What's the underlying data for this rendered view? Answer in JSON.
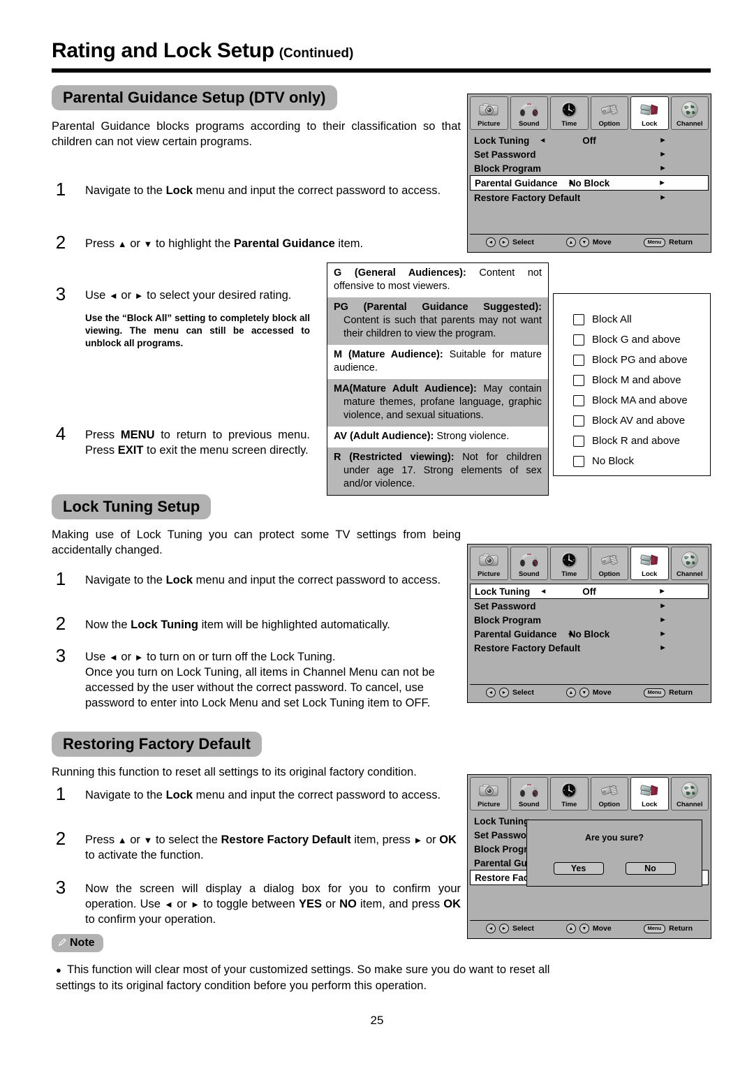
{
  "header": {
    "title_main": "Rating and Lock Setup",
    "title_suffix": "(Continued)"
  },
  "sections": {
    "parental": {
      "chip": "Parental Guidance Setup (DTV only)",
      "intro": "Parental Guidance blocks programs according to their classification so that children can not view certain programs."
    },
    "lock_tuning": {
      "chip": "Lock Tuning Setup",
      "intro": "Making use of Lock Tuning you can protect some TV settings from being accidentally changed."
    },
    "restoring": {
      "chip": "Restoring Factory Default",
      "intro": "Running this function to reset all settings to its original factory condition."
    },
    "note": {
      "chip": "Note",
      "bullet": "●",
      "text": "This function will clear most of your customized settings.  So make sure you do want to reset all settings to its original factory condition before you perform this operation."
    }
  },
  "steps_parental": [
    {
      "num": "1",
      "text_html": "Navigate to the <b>Lock</b> menu and input the correct password to access."
    },
    {
      "num": "2",
      "text_html": "Press <span class=\"arr\">▲</span> or <span class=\"arr\">▼</span> to highlight the <b>Parental Guidance</b> item."
    },
    {
      "num": "3",
      "text_html": "Use <span class=\"arr\">◄</span> or <span class=\"arr\">►</span> to select your desired rating.",
      "sub_bold": "Use the “Block All” setting to completely block all viewing. The menu can still be accessed to unblock all programs."
    },
    {
      "num": "4",
      "text_html": "Press <b>MENU</b> to return to previous menu. Press <b>EXIT</b> to exit the menu screen directly."
    }
  ],
  "steps_lock": [
    {
      "num": "1",
      "text_html": "Navigate to the <b>Lock</b> menu and input the correct password to access."
    },
    {
      "num": "2",
      "text_html": "Now the <b>Lock Tuning</b> item will be highlighted automatically."
    },
    {
      "num": "3",
      "text_html": "Use <span class=\"arr\">◄</span> or <span class=\"arr\">►</span> to turn on or turn off the Lock Tuning.<br>Once you turn on Lock Tuning, all items in Channel Menu can not be accessed by the user without the correct password. To cancel, use password to enter into Lock Menu and set Lock Tuning item to OFF."
    }
  ],
  "steps_restore": [
    {
      "num": "1",
      "text_html": "Navigate to the <b>Lock</b> menu and input the correct password to access."
    },
    {
      "num": "2",
      "text_html": "Press <span class=\"arr\">▲</span> or <span class=\"arr\">▼</span> to select the <b>Restore Factory Default</b> item, press <span class=\"arr\">►</span> or <b>OK</b> to activate the function."
    },
    {
      "num": "3",
      "text_html": "Now the screen will display a dialog box for you to confirm your operation. Use <span class=\"arr\">◄</span> or <span class=\"arr\">►</span> to toggle between <b>YES</b> or <b>NO</b> item, and press <b>OK</b> to confirm your operation."
    }
  ],
  "ratings": [
    {
      "code": "G (General Audiences):",
      "desc": " Content not offensive to most viewers.",
      "shaded": false,
      "indent": false
    },
    {
      "code": "PG (Parental Guidance Suggested):",
      "desc": " Content is such that parents may not want their children to view the program.",
      "shaded": true,
      "indent": true
    },
    {
      "code": "M (Mature Audience):",
      "desc": " Suitable for mature audience.",
      "shaded": false,
      "indent": false
    },
    {
      "code": "MA(Mature Adult Audience):",
      "desc": " May contain mature themes, profane language, graphic violence, and sexual situations.",
      "shaded": true,
      "indent": true
    },
    {
      "code": "AV (Adult Audience):",
      "desc": " Strong violence.",
      "shaded": false,
      "indent": false
    },
    {
      "code": "R (Restricted viewing):",
      "desc": " Not for children under age 17. Strong elements of sex and/or violence.",
      "shaded": true,
      "indent": true
    }
  ],
  "block_options": [
    {
      "label": "Block All",
      "checked": false
    },
    {
      "label": "Block G and above",
      "checked": false
    },
    {
      "label": "Block PG and above",
      "checked": false
    },
    {
      "label": "Block M and above",
      "checked": false
    },
    {
      "label": "Block MA and above",
      "checked": false
    },
    {
      "label": "Block AV and above",
      "checked": false
    },
    {
      "label": "Block R and above",
      "checked": false
    },
    {
      "label": "No Block",
      "checked": false
    }
  ],
  "osd": {
    "tabs": [
      {
        "label": "Picture",
        "icon": "camera-icon",
        "active": false
      },
      {
        "label": "Sound",
        "icon": "headphones-icon",
        "active": false
      },
      {
        "label": "Time",
        "icon": "clock-icon",
        "active": false
      },
      {
        "label": "Option",
        "icon": "connector-icon",
        "active": false
      },
      {
        "label": "Lock",
        "icon": "padlock-icon",
        "active": true
      },
      {
        "label": "Channel",
        "icon": "globe-icon",
        "active": false
      }
    ],
    "footer": {
      "select_keys": "◄►",
      "select_label": "Select",
      "move_keys": "▲▼",
      "move_label": "Move",
      "menu_key": "Menu",
      "menu_label": "Return"
    },
    "menu1": {
      "rows": [
        {
          "label": "Lock Tuning",
          "value": "Off",
          "left_arrow": true,
          "right_arrow": true,
          "selected": false
        },
        {
          "label": "Set Password",
          "value": "",
          "left_arrow": false,
          "right_arrow": true,
          "selected": false
        },
        {
          "label": "Block Program",
          "value": "",
          "left_arrow": false,
          "right_arrow": true,
          "selected": false
        },
        {
          "label": "Parental Guidance",
          "value": "No Block",
          "left_arrow": true,
          "right_arrow": true,
          "selected": true
        },
        {
          "label": "Restore Factory Default",
          "value": "",
          "left_arrow": false,
          "right_arrow": true,
          "selected": false
        }
      ]
    },
    "menu2": {
      "rows": [
        {
          "label": "Lock Tuning",
          "value": "Off",
          "left_arrow": true,
          "right_arrow": true,
          "selected": true
        },
        {
          "label": "Set Password",
          "value": "",
          "left_arrow": false,
          "right_arrow": true,
          "selected": false
        },
        {
          "label": "Block Program",
          "value": "",
          "left_arrow": false,
          "right_arrow": true,
          "selected": false
        },
        {
          "label": "Parental Guidance",
          "value": "No Block",
          "left_arrow": true,
          "right_arrow": true,
          "selected": false
        },
        {
          "label": "Restore Factory Default",
          "value": "",
          "left_arrow": false,
          "right_arrow": true,
          "selected": false
        }
      ]
    },
    "menu3": {
      "rows": [
        {
          "label": "Lock Tuning",
          "value": "",
          "left_arrow": false,
          "right_arrow": false,
          "selected": false
        },
        {
          "label": "Set Password",
          "value": "",
          "left_arrow": false,
          "right_arrow": false,
          "selected": false
        },
        {
          "label": "Block Program",
          "value": "",
          "left_arrow": false,
          "right_arrow": false,
          "selected": false
        },
        {
          "label": "Parental Guidance",
          "value": "",
          "left_arrow": false,
          "right_arrow": false,
          "selected": false
        },
        {
          "label": "Restore Factory Default",
          "value": "",
          "left_arrow": false,
          "right_arrow": false,
          "selected": true
        }
      ],
      "dialog": {
        "title": "Are you sure?",
        "yes": "Yes",
        "no": "No"
      }
    }
  },
  "page_number": "25",
  "colors": {
    "chip_bg": "#b2b2b2",
    "osd_bg": "#b0b0b0",
    "shade_row": "#b8b8b8",
    "accent": "#000000"
  }
}
